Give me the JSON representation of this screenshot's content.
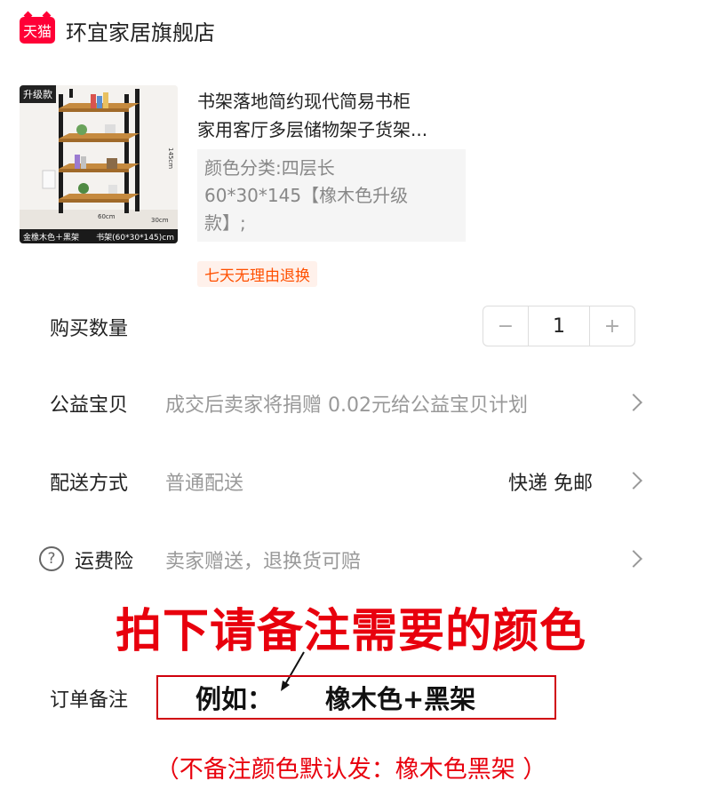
{
  "shop": {
    "badge": "天猫",
    "name": "环宜家居旗舰店"
  },
  "product": {
    "thumb_badge": "升级款",
    "thumb_caption_left": "金橡木色＋黑架",
    "thumb_caption_right": "书架(60*30*145)cm",
    "thumb_dim_height": "145cm",
    "thumb_dim_width": "60cm",
    "thumb_dim_depth": "30cm",
    "title_line1": "书架落地简约现代简易书柜",
    "title_line2": "家用客厅多层储物架子货架...",
    "sku_line1": "颜色分类:四层长",
    "sku_line2": "60*30*145【橡木色升级",
    "sku_line3": "款】;",
    "return_tag": "七天无理由退换"
  },
  "quantity": {
    "label": "购买数量",
    "minus": "−",
    "value": "1",
    "plus": "+"
  },
  "charity": {
    "label": "公益宝贝",
    "value": "成交后卖家将捐赠 0.02元给公益宝贝计划"
  },
  "delivery": {
    "label": "配送方式",
    "value": "普通配送",
    "right": "快递 免邮"
  },
  "insurance": {
    "icon_glyph": "?",
    "label": "运费险",
    "value": "卖家赠送，退换货可赔"
  },
  "annotation": {
    "headline": "拍下请备注需要的颜色",
    "remark_label": "订单备注",
    "remark_example": "例如：",
    "remark_value": "橡木色+黑架",
    "footnote": "（不备注颜色默认发：橡木色黑架 ）"
  },
  "colors": {
    "brand_red": "#ff0036",
    "accent_orange": "#ff5000",
    "note_red": "#e8000d"
  }
}
